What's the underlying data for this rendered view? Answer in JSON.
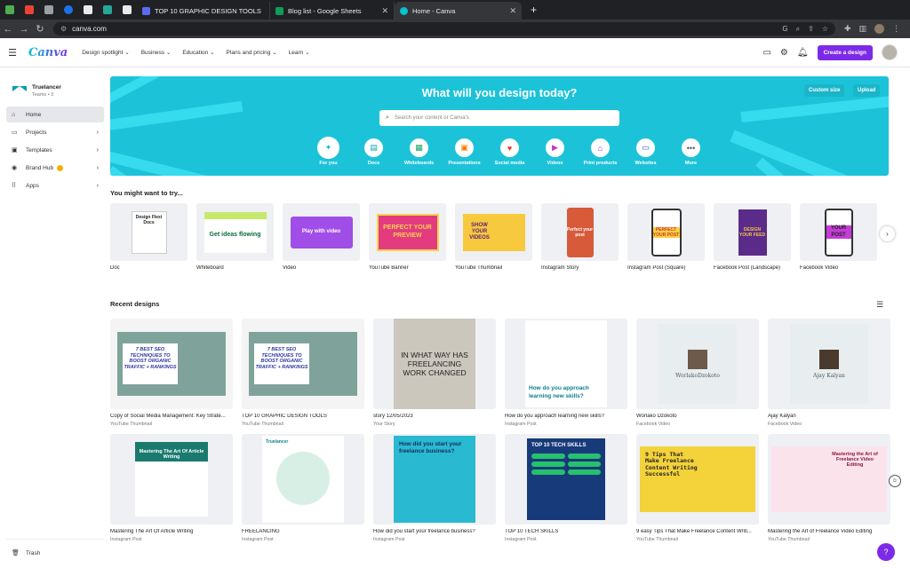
{
  "browser": {
    "tabs": [
      {
        "title": "TOP 10 GRAPHIC DESIGN TOOLS",
        "color": "#5b6cf0"
      },
      {
        "title": "Blog list - Google Sheets",
        "color": "#0f9d58"
      },
      {
        "title": "Home - Canva",
        "color": "#00c4cc"
      }
    ],
    "new_tab": "+",
    "url": "canva.com"
  },
  "header": {
    "logo": "Canva",
    "nav": [
      "Design spotlight",
      "Business",
      "Education",
      "Plans and pricing",
      "Learn"
    ],
    "create_label": "Create a design"
  },
  "sidebar": {
    "team_name": "Truelancer",
    "team_sub": "Teams • 3",
    "items": [
      {
        "label": "Home",
        "icon": "home-icon"
      },
      {
        "label": "Projects",
        "icon": "folder-icon"
      },
      {
        "label": "Templates",
        "icon": "templates-icon"
      },
      {
        "label": "Brand Hub",
        "icon": "brand-icon"
      },
      {
        "label": "Apps",
        "icon": "apps-icon"
      }
    ],
    "trash": "Trash"
  },
  "hero": {
    "title": "What will you design today?",
    "custom_size": "Custom size",
    "upload": "Upload",
    "search_placeholder": "Search your content or Canva's",
    "categories": [
      {
        "label": "For you",
        "color": "#00c4cc",
        "glyph": "✦"
      },
      {
        "label": "Docs",
        "color": "#13a3b5",
        "glyph": "▤"
      },
      {
        "label": "Whiteboards",
        "color": "#0fa361",
        "glyph": "▦"
      },
      {
        "label": "Presentations",
        "color": "#f57c00",
        "glyph": "▣"
      },
      {
        "label": "Social media",
        "color": "#e53935",
        "glyph": "♥"
      },
      {
        "label": "Videos",
        "color": "#c239c8",
        "glyph": "▶"
      },
      {
        "label": "Print products",
        "color": "#8e3ad8",
        "glyph": "⌂"
      },
      {
        "label": "Websites",
        "color": "#4a4fd8",
        "glyph": "▭"
      },
      {
        "label": "More",
        "color": "#555555",
        "glyph": "•••"
      }
    ]
  },
  "try_section": {
    "title": "You might want to try...",
    "items": [
      {
        "label": "Doc",
        "thumb": "Design Flexi Docs"
      },
      {
        "label": "Whiteboard",
        "thumb": "Get ideas flowing"
      },
      {
        "label": "Video",
        "thumb": "Play with video"
      },
      {
        "label": "YouTube Banner",
        "thumb": "PERFECT YOUR PREVIEW"
      },
      {
        "label": "YouTube Thumbnail",
        "thumb": "SHOW YOUR VIDEOS"
      },
      {
        "label": "Instagram Story",
        "thumb": "Perfect your post"
      },
      {
        "label": "Instagram Post (Square)",
        "thumb": "PERFECT YOUR POST"
      },
      {
        "label": "Facebook Post (Landscape)",
        "thumb": "DESIGN YOUR FEED"
      },
      {
        "label": "Facebook Video",
        "thumb": "YOUR POST"
      }
    ]
  },
  "recent": {
    "title": "Recent designs",
    "items": [
      {
        "title": "Copy of Social Media Management: Key Strate...",
        "type": "YouTube Thumbnail",
        "thumb": "7 BEST SEO TECHNIQUES TO BOOST ORGANIC TRAFFIC + RANKINGS"
      },
      {
        "title": "TOP 10 GRAPHIC DESIGN TOOLS",
        "type": "YouTube Thumbnail",
        "thumb": "7 BEST SEO TECHNIQUES TO BOOST ORGANIC TRAFFIC + RANKINGS"
      },
      {
        "title": "story 12/05/2023",
        "type": "Your Story",
        "thumb": "IN WHAT WAY HAS FREELANCING WORK CHANGED"
      },
      {
        "title": "How do you approach learning new skills?",
        "type": "Instagram Post",
        "thumb": "How do you approach learning new skills?"
      },
      {
        "title": "Worlako Dzokoto",
        "type": "Facebook Video",
        "thumb": "WorlakoDzokoto"
      },
      {
        "title": "Ajay Kalyan",
        "type": "Facebook Video",
        "thumb": "Ajay Kalyan"
      },
      {
        "title": "Mastering The Art Of Article Writing",
        "type": "Instagram Post",
        "thumb": "Mastering The Art Of Article Writing"
      },
      {
        "title": "FREELANCING",
        "type": "Instagram Post",
        "thumb": "Truelancer"
      },
      {
        "title": "How did you start your freelance business?",
        "type": "Instagram Post",
        "thumb": "How did you start your freelance business?"
      },
      {
        "title": "TOP 10 TECH SKILLS",
        "type": "Instagram Post",
        "thumb": "TOP 10 TECH SKILLS"
      },
      {
        "title": "9 easy Tips That Make Freelance Content Writi...",
        "type": "YouTube Thumbnail",
        "thumb": "9 Tips That Make Freelance Content Writing Successful"
      },
      {
        "title": "Mastering the Art of Freelance Video Editing",
        "type": "YouTube Thumbnail",
        "thumb": "Mastering the Art of Freelance Video Editing"
      }
    ]
  }
}
